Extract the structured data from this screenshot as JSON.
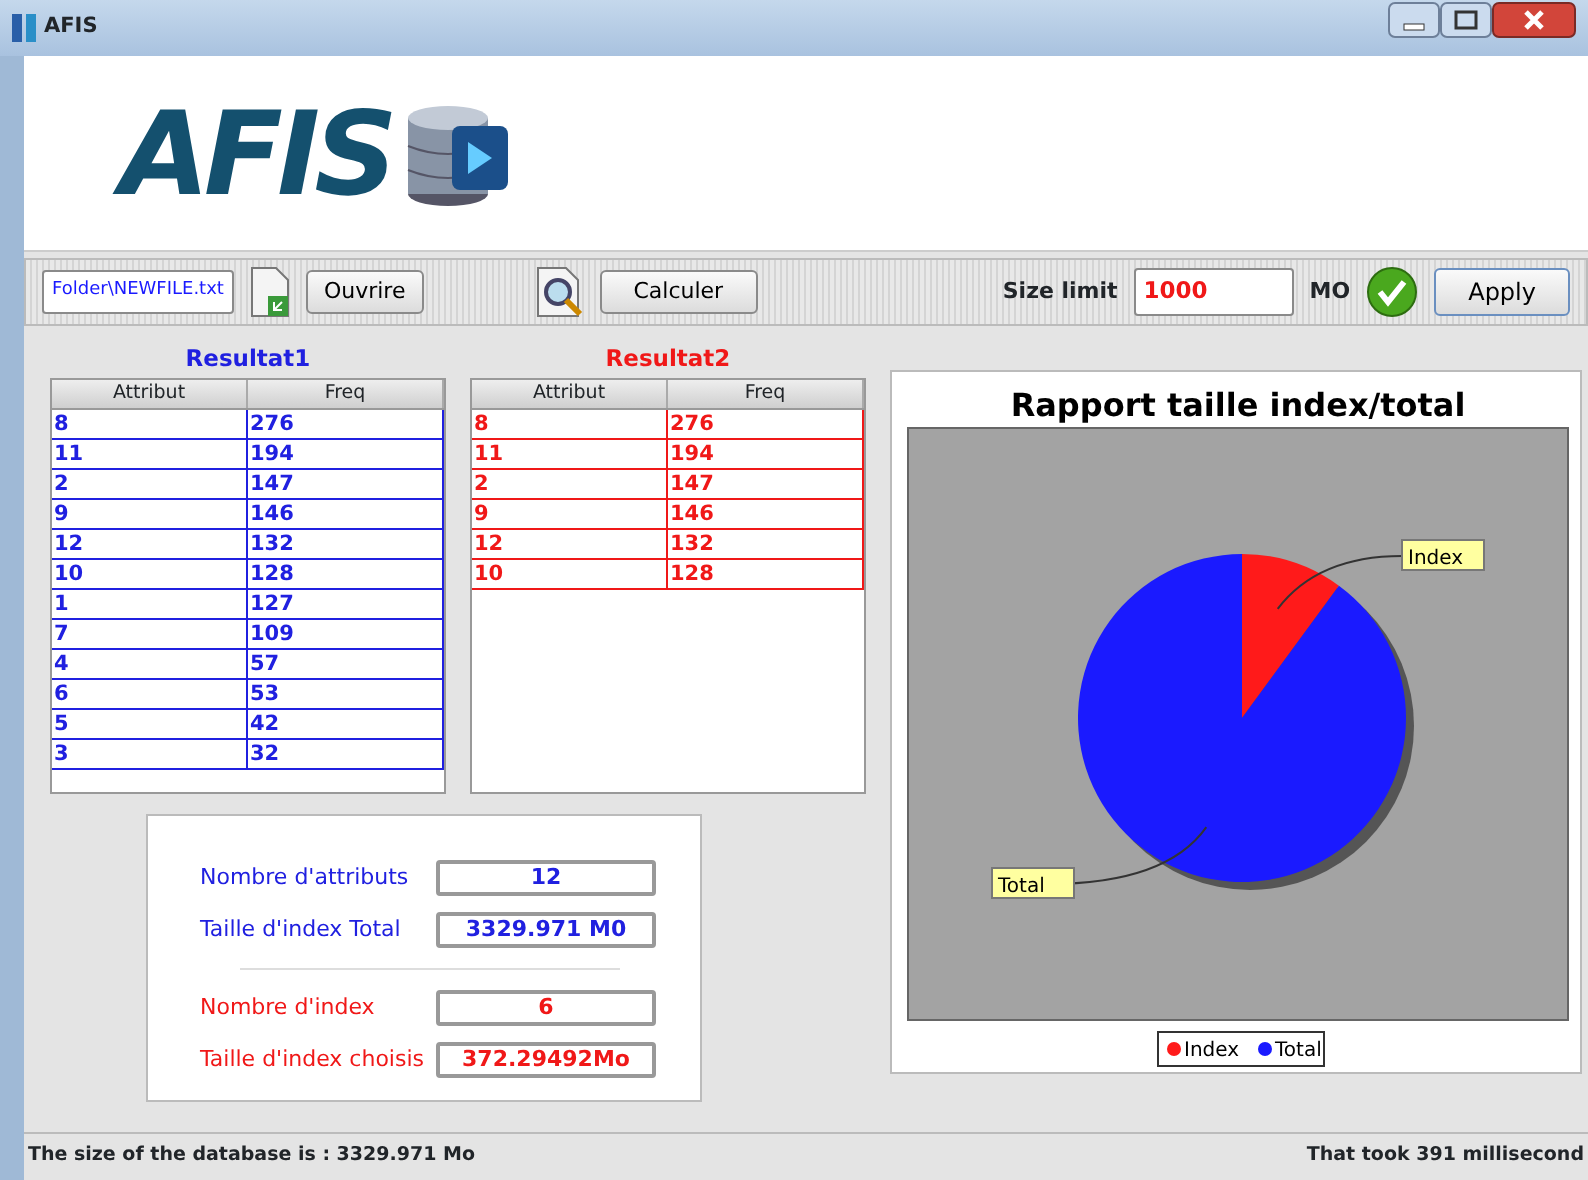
{
  "window": {
    "title": "AFIS"
  },
  "logo": {
    "text": "AFIS"
  },
  "toolbar": {
    "file_field": "Folder\\NEWFILE.txt",
    "open_button": "Ouvrire",
    "calc_button": "Calculer",
    "size_label": "Size limit",
    "size_value": "1000",
    "size_unit": "MO",
    "apply_button": "Apply"
  },
  "tables": [
    {
      "title": "Resultat1",
      "color": "#2020e0",
      "columns": [
        "Attribut",
        "Freq"
      ],
      "rows": [
        [
          "8",
          "276"
        ],
        [
          "11",
          "194"
        ],
        [
          "2",
          "147"
        ],
        [
          "9",
          "146"
        ],
        [
          "12",
          "132"
        ],
        [
          "10",
          "128"
        ],
        [
          "1",
          "127"
        ],
        [
          "7",
          "109"
        ],
        [
          "4",
          "57"
        ],
        [
          "6",
          "53"
        ],
        [
          "5",
          "42"
        ],
        [
          "3",
          "32"
        ]
      ]
    },
    {
      "title": "Resultat2",
      "color": "#f01818",
      "columns": [
        "Attribut",
        "Freq"
      ],
      "rows": [
        [
          "8",
          "276"
        ],
        [
          "11",
          "194"
        ],
        [
          "2",
          "147"
        ],
        [
          "9",
          "146"
        ],
        [
          "12",
          "132"
        ],
        [
          "10",
          "128"
        ]
      ]
    }
  ],
  "summary": [
    {
      "color": "#2020e0",
      "rows": [
        {
          "label": "Nombre d'attributs",
          "value": "12"
        },
        {
          "label": "Taille d'index Total",
          "value": "3329.971 M0"
        }
      ]
    },
    {
      "color": "#f01818",
      "rows": [
        {
          "label": "Nombre d'index",
          "value": "6"
        },
        {
          "label": "Taille d'index choisis",
          "value": "372.29492Mo"
        }
      ]
    }
  ],
  "chart": {
    "chart_data": {
      "type": "pie",
      "title": "Rapport taille index/total",
      "categories": [
        "Index",
        "Total"
      ],
      "values": [
        10.06,
        89.94
      ],
      "colors": [
        "#ff1a1a",
        "#1a1aff"
      ],
      "legend": "bottom"
    }
  },
  "status_bar": {
    "left": "The size of the database is : 3329.971 Mo",
    "right": "That took 391 millisecond"
  }
}
